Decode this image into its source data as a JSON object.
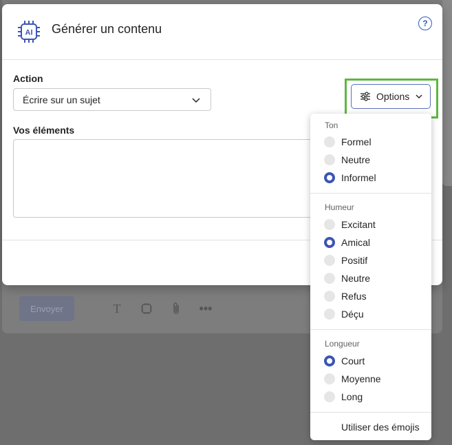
{
  "dialog": {
    "title": "Générer un contenu",
    "help": "?",
    "action_label": "Action",
    "action_value": "Écrire sur un sujet",
    "elements_label": "Vos éléments",
    "options_label": "Options"
  },
  "menu": {
    "groups": [
      {
        "title": "Ton",
        "options": [
          {
            "label": "Formel",
            "selected": false
          },
          {
            "label": "Neutre",
            "selected": false
          },
          {
            "label": "Informel",
            "selected": true
          }
        ]
      },
      {
        "title": "Humeur",
        "options": [
          {
            "label": "Excitant",
            "selected": false
          },
          {
            "label": "Amical",
            "selected": true
          },
          {
            "label": "Positif",
            "selected": false
          },
          {
            "label": "Neutre",
            "selected": false
          },
          {
            "label": "Refus",
            "selected": false
          },
          {
            "label": "Déçu",
            "selected": false
          }
        ]
      },
      {
        "title": "Longueur",
        "options": [
          {
            "label": "Court",
            "selected": true
          },
          {
            "label": "Moyenne",
            "selected": false
          },
          {
            "label": "Long",
            "selected": false
          }
        ]
      }
    ],
    "emoji_label": "Utiliser des émojis"
  },
  "background": {
    "send_label": "Envoyer",
    "icons": [
      "text-format-icon",
      "ai-chip-icon",
      "attach-icon",
      "more-icon"
    ]
  },
  "colors": {
    "accent": "#3c55b3",
    "highlight": "#5bb83f"
  }
}
